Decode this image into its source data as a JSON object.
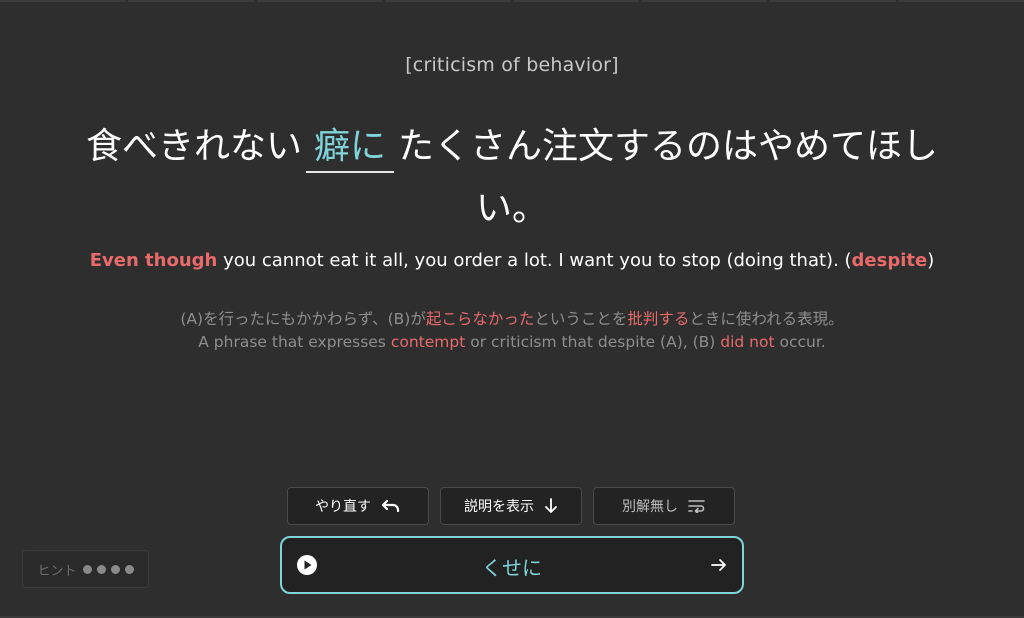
{
  "category": "[criticism of behavior]",
  "sentence": {
    "before": "食べきれない",
    "blank": "癖に",
    "after": "たくさん注文するのはやめてほしい。"
  },
  "translation": {
    "part1": "Even though",
    "part2": " you cannot eat it all, you order a lot. I want you to stop (doing that). (",
    "part3": "despite",
    "part4": ")"
  },
  "explanation_jp": {
    "a": "(A)を行ったにもかかわらず、(B)が",
    "b": "起こらなかった",
    "c": "ということを",
    "d": "批判する",
    "e": "ときに使われる表現。"
  },
  "explanation_en": {
    "a": "A phrase that expresses ",
    "b": "contempt",
    "c": " or criticism that despite (A), (B) ",
    "d": "did not",
    "e": " occur."
  },
  "buttons": {
    "redo": "やり直す",
    "show_explanation": "説明を表示",
    "no_alt": "別解無し"
  },
  "answer": {
    "text": "くせに"
  },
  "hint": {
    "label": "ヒント"
  },
  "colors": {
    "accent": "#7fd3d9",
    "highlight": "#e86a6a",
    "background": "#2e2e2e"
  }
}
